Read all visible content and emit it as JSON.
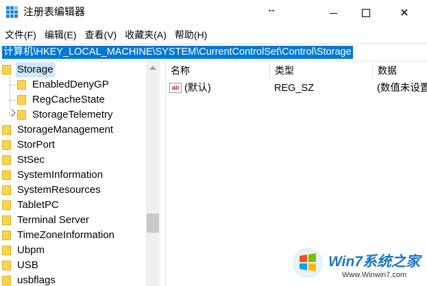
{
  "window": {
    "title": "注册表编辑器",
    "resize_glyph": "↔",
    "close_glyph": "✕"
  },
  "menu": [
    "文件(F)",
    "编辑(E)",
    "查看(V)",
    "收藏夹(A)",
    "帮助(H)"
  ],
  "address": "计算机\\HKEY_LOCAL_MACHINE\\SYSTEM\\CurrentControlSet\\Control\\Storage",
  "tree": {
    "items": [
      {
        "label": "Storage",
        "selected": true
      },
      {
        "label": "EnabledDenyGP"
      },
      {
        "label": "RegCacheState"
      },
      {
        "label": "StorageTelemetry"
      },
      {
        "label": "StorageManagement"
      },
      {
        "label": "StorPort"
      },
      {
        "label": "StSec"
      },
      {
        "label": "SystemInformation"
      },
      {
        "label": "SystemResources"
      },
      {
        "label": "TabletPC"
      },
      {
        "label": "Terminal Server"
      },
      {
        "label": "TimeZoneInformation"
      },
      {
        "label": "Ubpm"
      },
      {
        "label": "USB"
      },
      {
        "label": "usbflags"
      }
    ]
  },
  "list": {
    "columns": [
      "名称",
      "类型",
      "数据"
    ],
    "rows": [
      {
        "icon": "ab",
        "name": "(默认)",
        "type": "REG_SZ",
        "data": "(数值未设置"
      }
    ]
  },
  "watermark": {
    "brand": "Win7系统之家",
    "url": "Www.Winwin7.com"
  },
  "colors": {
    "selection_accent": "#0078d7",
    "tree_selection": "#cce8ff",
    "folder": "#ffd34e"
  }
}
